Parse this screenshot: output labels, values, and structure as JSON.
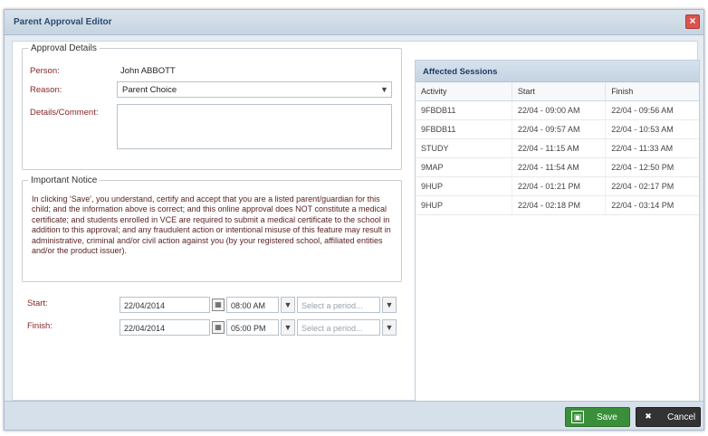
{
  "window": {
    "title": "Parent Approval Editor"
  },
  "details": {
    "legend": "Approval Details",
    "person_label": "Person:",
    "person_value": "John ABBOTT",
    "reason_label": "Reason:",
    "reason_value": "Parent Choice",
    "comment_label": "Details/Comment:",
    "comment_value": ""
  },
  "notice": {
    "legend": "Important Notice",
    "text": "In clicking 'Save', you understand, certify and accept that you are a listed parent/guardian for this child; and the information above is correct; and this online approval does NOT constitute a medical certificate; and students enrolled in VCE are required to submit a medical certificate to the school in addition to this approval; and any fraudulent action or intentional misuse of this feature may result in administrative, criminal and/or civil action against you (by your registered school, affiliated entities and/or the product issuer)."
  },
  "schedule": {
    "start_label": "Start:",
    "start_date": "22/04/2014",
    "start_time": "08:00 AM",
    "finish_label": "Finish:",
    "finish_date": "22/04/2014",
    "finish_time": "05:00 PM",
    "period_placeholder": "Select a period..."
  },
  "sessions": {
    "title": "Affected Sessions",
    "columns": [
      "Activity",
      "Start",
      "Finish"
    ],
    "rows": [
      [
        "9FBDB11",
        "22/04 - 09:00 AM",
        "22/04 - 09:56 AM"
      ],
      [
        "9FBDB11",
        "22/04 - 09:57 AM",
        "22/04 - 10:53 AM"
      ],
      [
        "STUDY",
        "22/04 - 11:15 AM",
        "22/04 - 11:33 AM"
      ],
      [
        "9MAP",
        "22/04 - 11:54 AM",
        "22/04 - 12:50 PM"
      ],
      [
        "9HUP",
        "22/04 - 01:21 PM",
        "22/04 - 02:17 PM"
      ],
      [
        "9HUP",
        "22/04 - 02:18 PM",
        "22/04 - 03:14 PM"
      ]
    ]
  },
  "footer": {
    "save_label": "Save",
    "cancel_label": "Cancel"
  },
  "colors": {
    "save": "#3a8f3a",
    "cancel": "#333333",
    "close": "#d9534f",
    "header": "#c6d4e1"
  },
  "icons": {
    "close": "close-icon",
    "dropdown": "chevron-down-icon",
    "calendar": "calendar-icon",
    "save": "save-icon",
    "cancel": "cancel-icon"
  }
}
